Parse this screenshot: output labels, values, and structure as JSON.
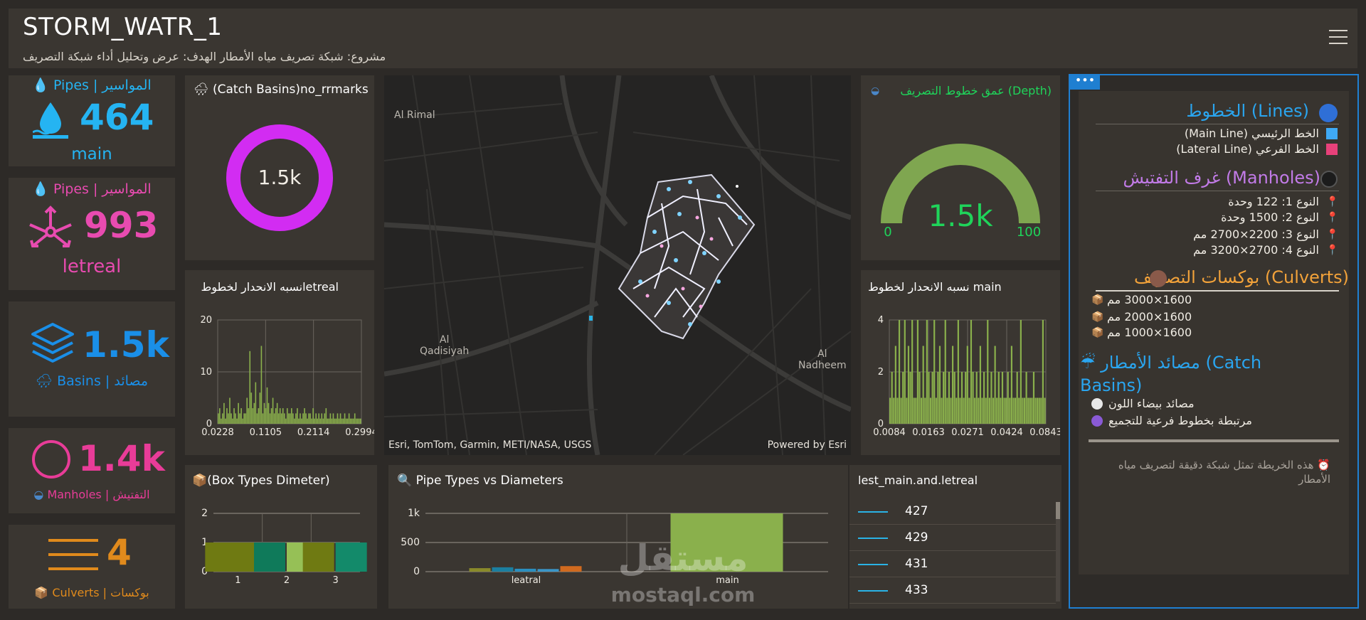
{
  "header": {
    "title": "STORM_WATR_1",
    "subtitle": "مشروع: شبكة تصريف مياه الأمطار الهدف: عرض وتحليل أداء شبكة التصريف"
  },
  "indicators": {
    "pipes_main": {
      "title": "💧 Pipes | المواسير",
      "value": "464",
      "footer": "main",
      "color": "#25b4f2"
    },
    "pipes_lateral": {
      "title": "💧 Pipes | المواسير",
      "value": "993",
      "footer": "letreal",
      "color": "#e84bb0"
    },
    "basins": {
      "value": "1.5k",
      "footer": "Basins | مصائد",
      "color": "#1a8fe8"
    },
    "manholes": {
      "value": "1.4k",
      "footer": "Manholes | التفتيش",
      "color": "#e83c98"
    },
    "culverts": {
      "value": "4",
      "footer": "Culverts | بوكسات",
      "color": "#e08a1c"
    }
  },
  "donut": {
    "title": "(Catch Basins)no_rrmarks",
    "value": "1.5k",
    "color": "#d22cf2"
  },
  "gauge": {
    "title": "عمق خطوط التصريف (Depth)",
    "value": "1.5k",
    "min": "0",
    "max": "100",
    "color": "#7fa650"
  },
  "map": {
    "labels": {
      "al_rimal": "Al Rimal",
      "al_qadisiyah": "Al\nQadisiyah",
      "al_nadheem": "Al\nNadheem"
    },
    "attribution": "Esri, TomTom, Garmin, METI/NASA, USGS",
    "powered_by": "Powered by Esri"
  },
  "histogram_lateral": {
    "title": "نسبه الانحدار لخطوطletreal",
    "chart_data": {
      "type": "bar",
      "x_tick_labels": [
        "0.0228",
        "0.1105",
        "0.2114",
        "0.2994"
      ],
      "y_tick_labels": [
        "0",
        "10",
        "20"
      ],
      "ylim": [
        0,
        20
      ],
      "values": [
        2,
        3,
        1,
        2,
        4,
        1,
        3,
        2,
        5,
        2,
        1,
        3,
        2,
        1,
        4,
        2,
        3,
        1,
        2,
        2,
        5,
        3,
        14,
        6,
        3,
        4,
        8,
        2,
        3,
        6,
        15,
        2,
        4,
        3,
        7,
        4,
        2,
        3,
        5,
        2,
        3,
        4,
        2,
        3,
        2,
        3,
        2,
        1,
        3,
        2,
        2,
        3,
        2,
        1,
        2,
        3,
        1,
        2,
        1,
        2,
        3,
        2,
        1,
        2,
        2,
        1,
        3,
        1,
        2,
        1,
        2,
        1,
        2,
        1,
        2,
        3,
        1,
        1,
        2,
        1,
        2,
        1,
        1,
        2,
        1,
        2,
        1,
        1,
        2,
        1,
        1,
        2,
        1,
        1,
        1,
        2,
        1,
        1,
        1,
        1
      ],
      "color": "#8ab04c"
    }
  },
  "histogram_main": {
    "title": "نسبه الانحدار لخطوط main",
    "chart_data": {
      "type": "bar",
      "x_tick_labels": [
        "0.0084",
        "0.0163",
        "0.0271",
        "0.0424",
        "0.0843"
      ],
      "y_tick_labels": [
        "0",
        "2",
        "4"
      ],
      "ylim": [
        0,
        4
      ],
      "values": [
        1,
        2,
        1,
        3,
        1,
        4,
        1,
        2,
        4,
        1,
        3,
        2,
        4,
        1,
        1,
        4,
        2,
        1,
        3,
        1,
        4,
        2,
        1,
        2,
        4,
        1,
        2,
        3,
        1,
        2,
        4,
        1,
        2,
        1,
        3,
        2,
        1,
        4,
        1,
        2,
        1,
        2,
        3,
        1,
        4,
        2,
        1,
        2,
        1,
        3,
        1,
        2,
        1,
        4,
        1,
        2,
        1,
        3,
        1,
        2,
        1,
        2,
        1,
        1,
        2,
        1,
        3,
        1,
        1,
        2,
        1,
        4,
        1,
        1,
        2,
        1,
        1,
        1,
        2,
        1,
        1,
        1,
        1,
        4,
        1
      ],
      "color": "#8ab04c"
    }
  },
  "box_chart": {
    "title": "📦(Box Types Dimeter)",
    "chart_data": {
      "type": "bar",
      "categories": [
        "1",
        "2",
        "3"
      ],
      "y_tick_labels": [
        "0",
        "1",
        "2"
      ],
      "ylim": [
        0,
        2
      ],
      "series": [
        {
          "values": [
            1,
            0,
            1
          ],
          "color": "#6f7a12"
        },
        {
          "values": [
            0,
            1,
            0
          ],
          "color": "#0f7a5a"
        },
        {
          "values": [
            0,
            1,
            0
          ],
          "color": "#96c056"
        },
        {
          "values": [
            0,
            0,
            1
          ],
          "color": "#138a6a"
        }
      ]
    }
  },
  "pipe_chart": {
    "title": "🔍 Pipe Types vs Diameters",
    "chart_data": {
      "type": "bar",
      "categories": [
        "leatral",
        "main"
      ],
      "y_tick_labels": [
        "0",
        "500",
        "1k"
      ],
      "ylim": [
        0,
        1000
      ],
      "series": [
        {
          "values": [
            60,
            0
          ],
          "color": "#8a8a2a"
        },
        {
          "values": [
            75,
            0
          ],
          "color": "#1b7fa0"
        },
        {
          "values": [
            50,
            0
          ],
          "color": "#2a8fc0"
        },
        {
          "values": [
            45,
            0
          ],
          "color": "#3a96c8"
        },
        {
          "values": [
            95,
            0
          ],
          "color": "#d06a1f"
        },
        {
          "values": [
            0,
            1000
          ],
          "color": "#8ab04c"
        }
      ]
    }
  },
  "table": {
    "title": "lest_main.and.letreal",
    "rows": [
      "427",
      "429",
      "431",
      "433"
    ]
  },
  "legend": {
    "lines": {
      "head": "الخطوط (Lines)",
      "items": [
        "الخط الرئيسي (Main Line)",
        "الخط الفرعي (Lateral Line)"
      ],
      "colors": [
        "#3fa9f5",
        "#e8417a"
      ],
      "head_color": "#2aa5ef"
    },
    "manholes": {
      "head": "غرف التفتيش (Manholes)",
      "items": [
        "النوع 1: 122 وحدة",
        "النوع 2: 1500 وحدة",
        "النوع 3: 2200×2700 مم",
        "النوع 4: 2700×3200 مم"
      ],
      "head_color": "#c27be8"
    },
    "culverts": {
      "head": "بوكسات التصريف (Culverts)",
      "items": [
        "1600×3000 مم",
        "1600×2000 مم",
        "1600×1000 مم"
      ],
      "head_color": "#f2a23a"
    },
    "basins": {
      "head": "مصائد الأمطار (Catch Basins)",
      "items": [
        "مصائد بيضاء اللون",
        "مرتبطة بخطوط فرعية للتجميع"
      ],
      "head_color": "#2aa5ef"
    },
    "note": "هذه الخريطة تمثل شبكة دقيقة لتصريف مياه الأمطار"
  },
  "watermark": {
    "arabic": "مستقل",
    "latin": "mostaql.com"
  }
}
